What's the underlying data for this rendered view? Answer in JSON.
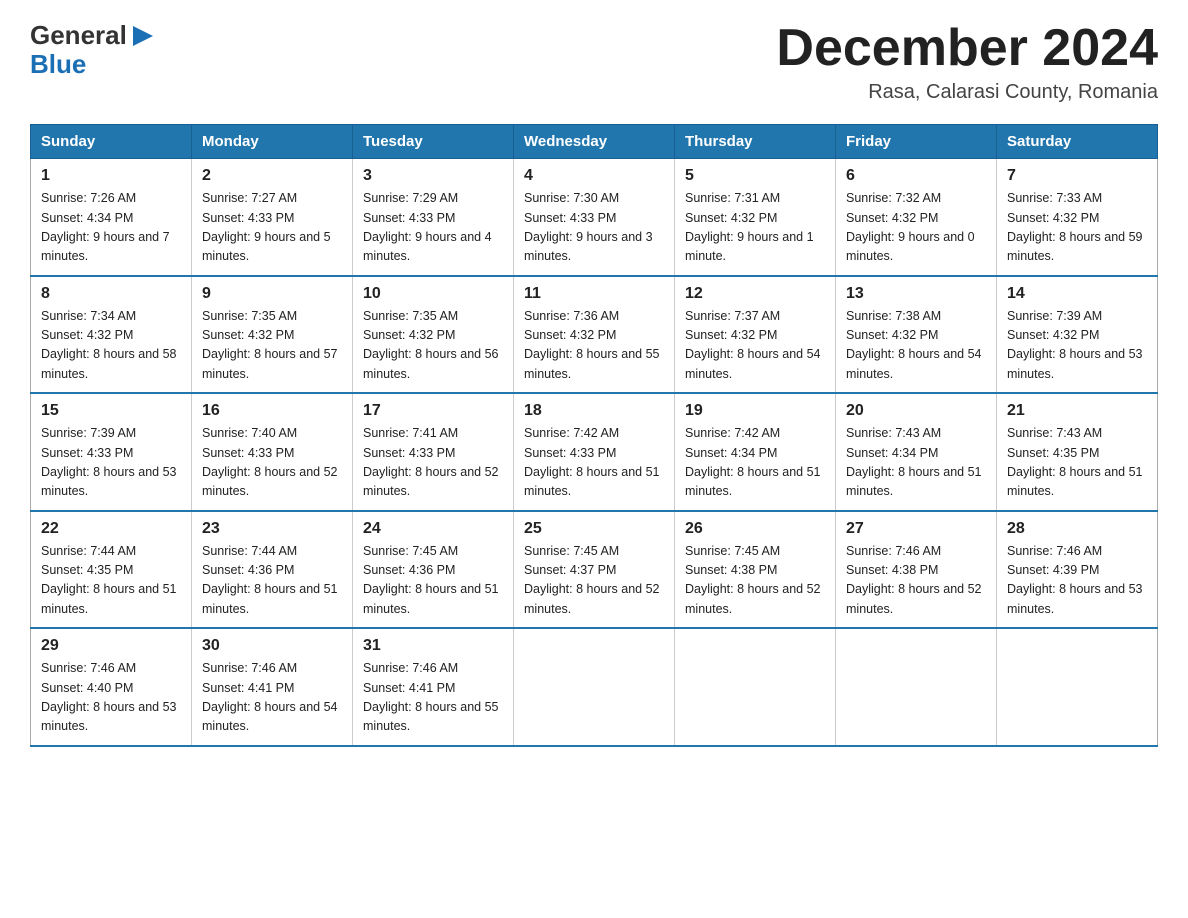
{
  "logo": {
    "general": "General",
    "arrow": "▶",
    "blue": "Blue"
  },
  "title": "December 2024",
  "location": "Rasa, Calarasi County, Romania",
  "days_of_week": [
    "Sunday",
    "Monday",
    "Tuesday",
    "Wednesday",
    "Thursday",
    "Friday",
    "Saturday"
  ],
  "weeks": [
    [
      {
        "day": "1",
        "sunrise": "7:26 AM",
        "sunset": "4:34 PM",
        "daylight": "9 hours and 7 minutes."
      },
      {
        "day": "2",
        "sunrise": "7:27 AM",
        "sunset": "4:33 PM",
        "daylight": "9 hours and 5 minutes."
      },
      {
        "day": "3",
        "sunrise": "7:29 AM",
        "sunset": "4:33 PM",
        "daylight": "9 hours and 4 minutes."
      },
      {
        "day": "4",
        "sunrise": "7:30 AM",
        "sunset": "4:33 PM",
        "daylight": "9 hours and 3 minutes."
      },
      {
        "day": "5",
        "sunrise": "7:31 AM",
        "sunset": "4:32 PM",
        "daylight": "9 hours and 1 minute."
      },
      {
        "day": "6",
        "sunrise": "7:32 AM",
        "sunset": "4:32 PM",
        "daylight": "9 hours and 0 minutes."
      },
      {
        "day": "7",
        "sunrise": "7:33 AM",
        "sunset": "4:32 PM",
        "daylight": "8 hours and 59 minutes."
      }
    ],
    [
      {
        "day": "8",
        "sunrise": "7:34 AM",
        "sunset": "4:32 PM",
        "daylight": "8 hours and 58 minutes."
      },
      {
        "day": "9",
        "sunrise": "7:35 AM",
        "sunset": "4:32 PM",
        "daylight": "8 hours and 57 minutes."
      },
      {
        "day": "10",
        "sunrise": "7:35 AM",
        "sunset": "4:32 PM",
        "daylight": "8 hours and 56 minutes."
      },
      {
        "day": "11",
        "sunrise": "7:36 AM",
        "sunset": "4:32 PM",
        "daylight": "8 hours and 55 minutes."
      },
      {
        "day": "12",
        "sunrise": "7:37 AM",
        "sunset": "4:32 PM",
        "daylight": "8 hours and 54 minutes."
      },
      {
        "day": "13",
        "sunrise": "7:38 AM",
        "sunset": "4:32 PM",
        "daylight": "8 hours and 54 minutes."
      },
      {
        "day": "14",
        "sunrise": "7:39 AM",
        "sunset": "4:32 PM",
        "daylight": "8 hours and 53 minutes."
      }
    ],
    [
      {
        "day": "15",
        "sunrise": "7:39 AM",
        "sunset": "4:33 PM",
        "daylight": "8 hours and 53 minutes."
      },
      {
        "day": "16",
        "sunrise": "7:40 AM",
        "sunset": "4:33 PM",
        "daylight": "8 hours and 52 minutes."
      },
      {
        "day": "17",
        "sunrise": "7:41 AM",
        "sunset": "4:33 PM",
        "daylight": "8 hours and 52 minutes."
      },
      {
        "day": "18",
        "sunrise": "7:42 AM",
        "sunset": "4:33 PM",
        "daylight": "8 hours and 51 minutes."
      },
      {
        "day": "19",
        "sunrise": "7:42 AM",
        "sunset": "4:34 PM",
        "daylight": "8 hours and 51 minutes."
      },
      {
        "day": "20",
        "sunrise": "7:43 AM",
        "sunset": "4:34 PM",
        "daylight": "8 hours and 51 minutes."
      },
      {
        "day": "21",
        "sunrise": "7:43 AM",
        "sunset": "4:35 PM",
        "daylight": "8 hours and 51 minutes."
      }
    ],
    [
      {
        "day": "22",
        "sunrise": "7:44 AM",
        "sunset": "4:35 PM",
        "daylight": "8 hours and 51 minutes."
      },
      {
        "day": "23",
        "sunrise": "7:44 AM",
        "sunset": "4:36 PM",
        "daylight": "8 hours and 51 minutes."
      },
      {
        "day": "24",
        "sunrise": "7:45 AM",
        "sunset": "4:36 PM",
        "daylight": "8 hours and 51 minutes."
      },
      {
        "day": "25",
        "sunrise": "7:45 AM",
        "sunset": "4:37 PM",
        "daylight": "8 hours and 52 minutes."
      },
      {
        "day": "26",
        "sunrise": "7:45 AM",
        "sunset": "4:38 PM",
        "daylight": "8 hours and 52 minutes."
      },
      {
        "day": "27",
        "sunrise": "7:46 AM",
        "sunset": "4:38 PM",
        "daylight": "8 hours and 52 minutes."
      },
      {
        "day": "28",
        "sunrise": "7:46 AM",
        "sunset": "4:39 PM",
        "daylight": "8 hours and 53 minutes."
      }
    ],
    [
      {
        "day": "29",
        "sunrise": "7:46 AM",
        "sunset": "4:40 PM",
        "daylight": "8 hours and 53 minutes."
      },
      {
        "day": "30",
        "sunrise": "7:46 AM",
        "sunset": "4:41 PM",
        "daylight": "8 hours and 54 minutes."
      },
      {
        "day": "31",
        "sunrise": "7:46 AM",
        "sunset": "4:41 PM",
        "daylight": "8 hours and 55 minutes."
      },
      null,
      null,
      null,
      null
    ]
  ],
  "labels": {
    "sunrise": "Sunrise:",
    "sunset": "Sunset:",
    "daylight": "Daylight:"
  }
}
